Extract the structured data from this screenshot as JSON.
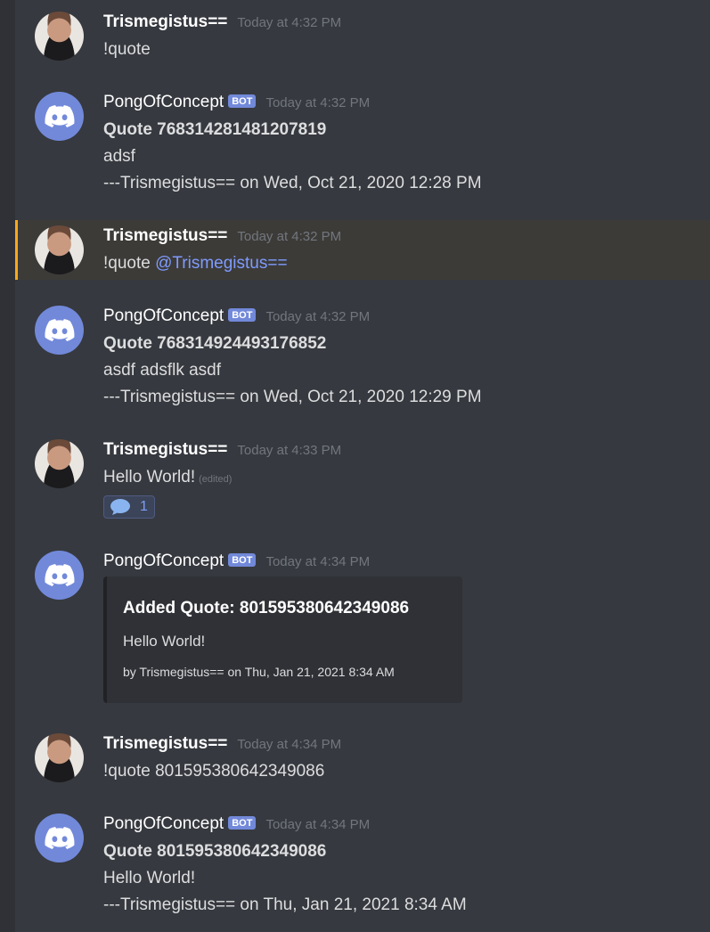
{
  "colors": {
    "background": "#36393f",
    "bot_tag": "#7289da",
    "mention": "#7f9bff",
    "highlight_bar": "#faa81a",
    "timestamp": "#72767d"
  },
  "messages": [
    {
      "author": "Trismegistus==",
      "timestamp": "Today at 4:32 PM",
      "content": "!quote"
    },
    {
      "author": "PongOfConcept",
      "bot_tag": "BOT",
      "timestamp": "Today at 4:32 PM",
      "quote_title": "Quote 768314281481207819",
      "quote_text": "adsf",
      "quote_attribution": " ---Trismegistus== on Wed, Oct 21, 2020 12:28 PM"
    },
    {
      "author": "Trismegistus==",
      "timestamp": "Today at 4:32 PM",
      "content_prefix": "!quote ",
      "mention": "@Trismegistus=="
    },
    {
      "author": "PongOfConcept",
      "bot_tag": "BOT",
      "timestamp": "Today at 4:32 PM",
      "quote_title": "Quote 768314924493176852",
      "quote_text": "asdf adsflk asdf",
      "quote_attribution": " ---Trismegistus== on Wed, Oct 21, 2020 12:29 PM"
    },
    {
      "author": "Trismegistus==",
      "timestamp": "Today at 4:33 PM",
      "content": "Hello World!",
      "edited": "(edited)",
      "reaction": {
        "icon": "speech-bubble-icon",
        "count": "1"
      }
    },
    {
      "author": "PongOfConcept",
      "bot_tag": "BOT",
      "timestamp": "Today at 4:34 PM",
      "embed": {
        "title": "Added Quote: 801595380642349086",
        "description": "Hello World!",
        "footer": "by Trismegistus== on Thu, Jan 21, 2021 8:34 AM"
      }
    },
    {
      "author": "Trismegistus==",
      "timestamp": "Today at 4:34 PM",
      "content": "!quote 801595380642349086"
    },
    {
      "author": "PongOfConcept",
      "bot_tag": "BOT",
      "timestamp": "Today at 4:34 PM",
      "quote_title": "Quote 801595380642349086",
      "quote_text": "Hello World!",
      "quote_attribution": " ---Trismegistus== on Thu, Jan 21, 2021 8:34 AM"
    }
  ]
}
